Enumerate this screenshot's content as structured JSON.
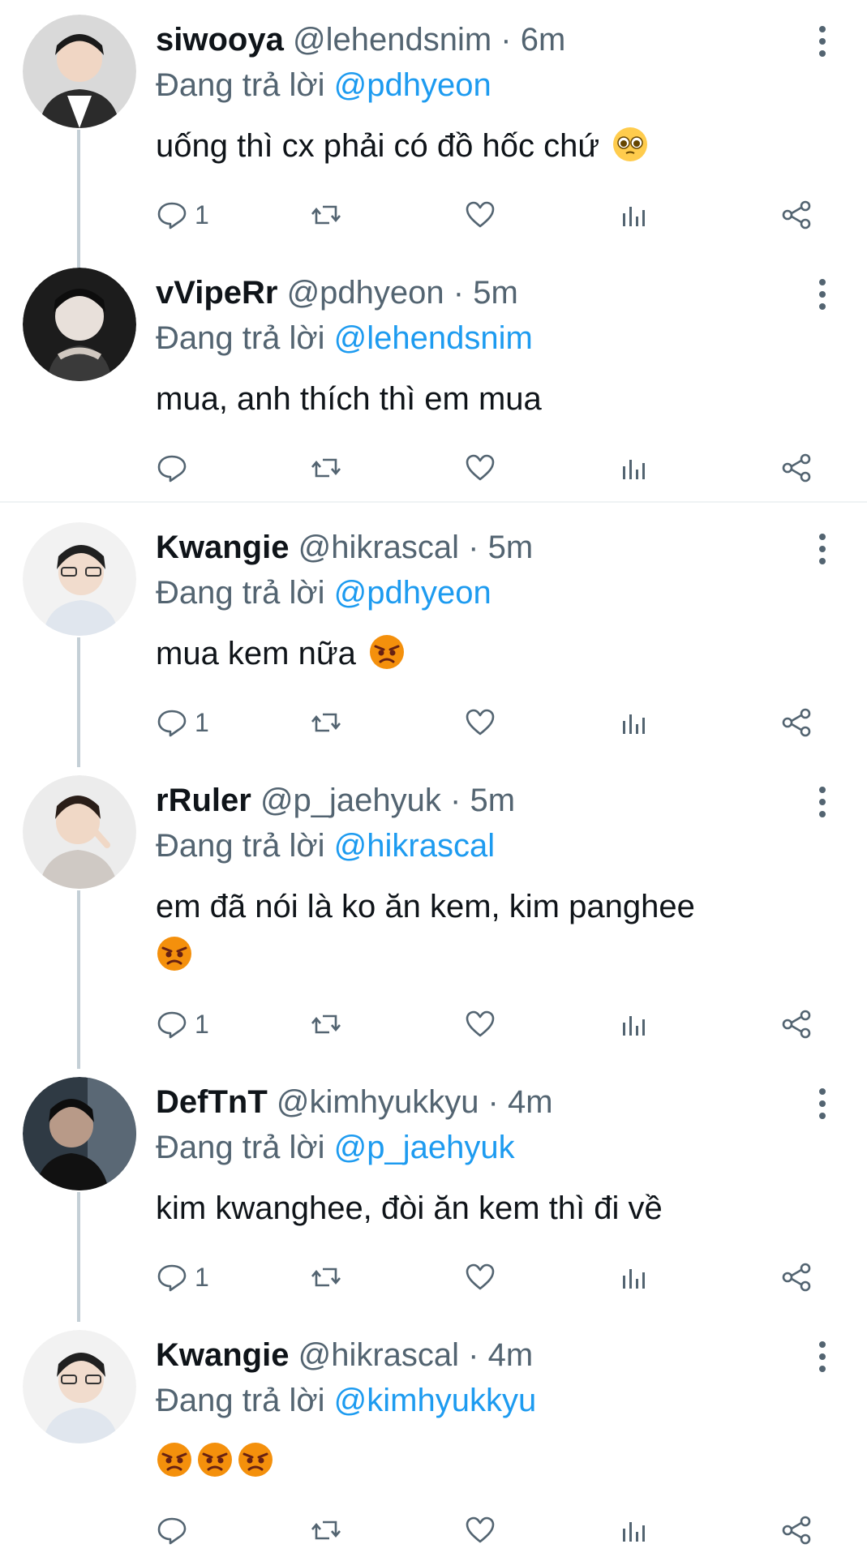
{
  "colors": {
    "text_primary": "#0f1419",
    "text_secondary": "#536471",
    "accent_blue": "#1d9bf0",
    "thread_line": "#c4cfd6",
    "divider": "#eff3f4"
  },
  "tweets": [
    {
      "display_name": "siwooya",
      "meta": "@lehendsnim · 6m",
      "reply_prefix": "Đang trả lời",
      "reply_to": "@pdhyeon",
      "text": "uống thì cx phải có đồ hốc chứ",
      "emojis": [
        "pleading-face-emoji"
      ],
      "reply_count": "1",
      "avatar": "avatar-photo"
    },
    {
      "display_name": "vVipeRr",
      "meta": "@pdhyeon · 5m",
      "reply_prefix": "Đang trả lời",
      "reply_to": "@lehendsnim",
      "text": "mua, anh thích thì em mua",
      "emojis": [],
      "reply_count": "",
      "avatar": "avatar-photo"
    },
    {
      "display_name": "Kwangie",
      "meta": "@hikrascal · 5m",
      "reply_prefix": "Đang trả lời",
      "reply_to": "@pdhyeon",
      "text": "mua kem nữa",
      "emojis": [
        "angry-face-emoji"
      ],
      "reply_count": "1",
      "avatar": "avatar-photo"
    },
    {
      "display_name": "rRuler",
      "meta": "@p_jaehyuk · 5m",
      "reply_prefix": "Đang trả lời",
      "reply_to": "@hikrascal",
      "text": "em đã nói là ko ăn kem, kim panghee",
      "emojis": [
        "angry-face-emoji"
      ],
      "reply_count": "1",
      "avatar": "avatar-photo"
    },
    {
      "display_name": "DefTnT",
      "meta": "@kimhyukkyu · 4m",
      "reply_prefix": "Đang trả lời",
      "reply_to": "@p_jaehyuk",
      "text": "kim kwanghee, đòi ăn kem thì đi về",
      "emojis": [],
      "reply_count": "1",
      "avatar": "avatar-photo"
    },
    {
      "display_name": "Kwangie",
      "meta": "@hikrascal · 4m",
      "reply_prefix": "Đang trả lời",
      "reply_to": "@kimhyukkyu",
      "text": "",
      "emojis": [
        "angry-face-emoji",
        "angry-face-emoji",
        "angry-face-emoji"
      ],
      "reply_count": "",
      "avatar": "avatar-photo"
    }
  ]
}
